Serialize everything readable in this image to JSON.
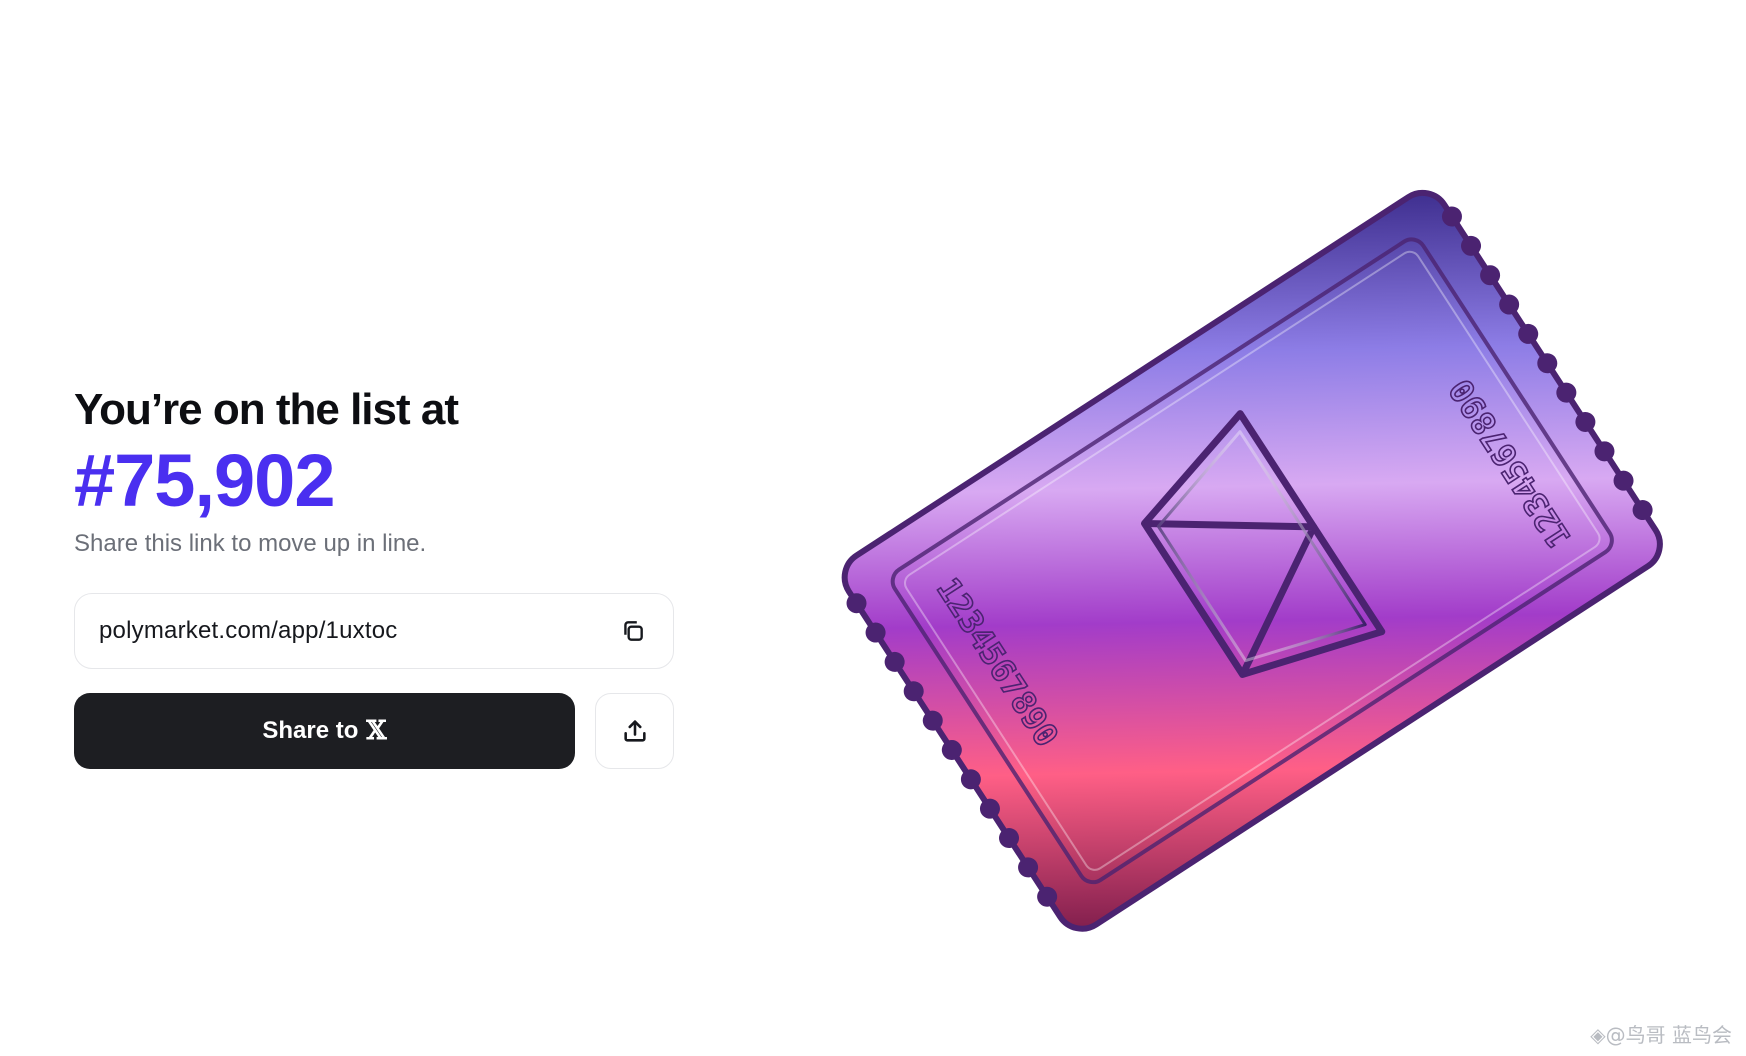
{
  "headline": "You’re on the list at",
  "rank": "#75,902",
  "subtitle": "Share this link to move up in line.",
  "referral": {
    "link": "polymarket.com/app/1uxtoc",
    "copy_icon": "copy-icon"
  },
  "share": {
    "label": "Share to",
    "platform_glyph": "𝕏",
    "upload_icon": "upload-icon"
  },
  "ticket": {
    "serial_top": "1234567890",
    "serial_bottom": "1234567890"
  },
  "watermark": "◈@鸟哥 蓝鸟会",
  "colors": {
    "accent": "#4a2ff0",
    "button_dark": "#1d1e22"
  }
}
